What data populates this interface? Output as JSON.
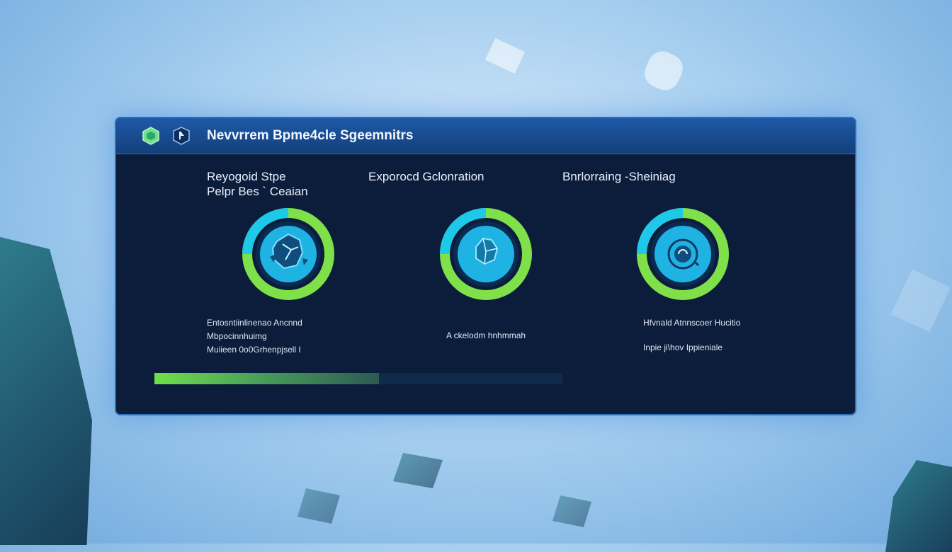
{
  "window": {
    "title": "Nevvrrem Bpme4cle Sgeemnitrs"
  },
  "columns": [
    {
      "heading_line1": "Reyogoid Stpe",
      "heading_line2": "Pelpr Bes  ` Ceaian",
      "icon": "shattered-orb-icon",
      "desc": [
        "Entosntiinlinenao Ancnnd",
        "Mbpocinnhuimg",
        "Muiieen 0o0Grhenpjsell I"
      ]
    },
    {
      "heading_line1": "Exporocd Gclonration",
      "heading_line2": "",
      "icon": "crystal-cluster-icon",
      "desc": [
        "A ckelodm hnhmmah"
      ]
    },
    {
      "heading_line1": "Bnrlorraing -Sheiniag",
      "heading_line2": "",
      "icon": "spiral-orb-icon",
      "desc": [
        "Hfvnald Atnnscoer Hucitio",
        "Inpie ji\\hov Ippieniale"
      ]
    }
  ],
  "progress": {
    "value": 0.55
  },
  "colors": {
    "panel_bg": "#0b1d3b",
    "titlebar": "#1d5aa7",
    "ring_cyan": "#1ec8e8",
    "ring_green": "#7fe04a",
    "progress_green": "#6fe04a"
  }
}
